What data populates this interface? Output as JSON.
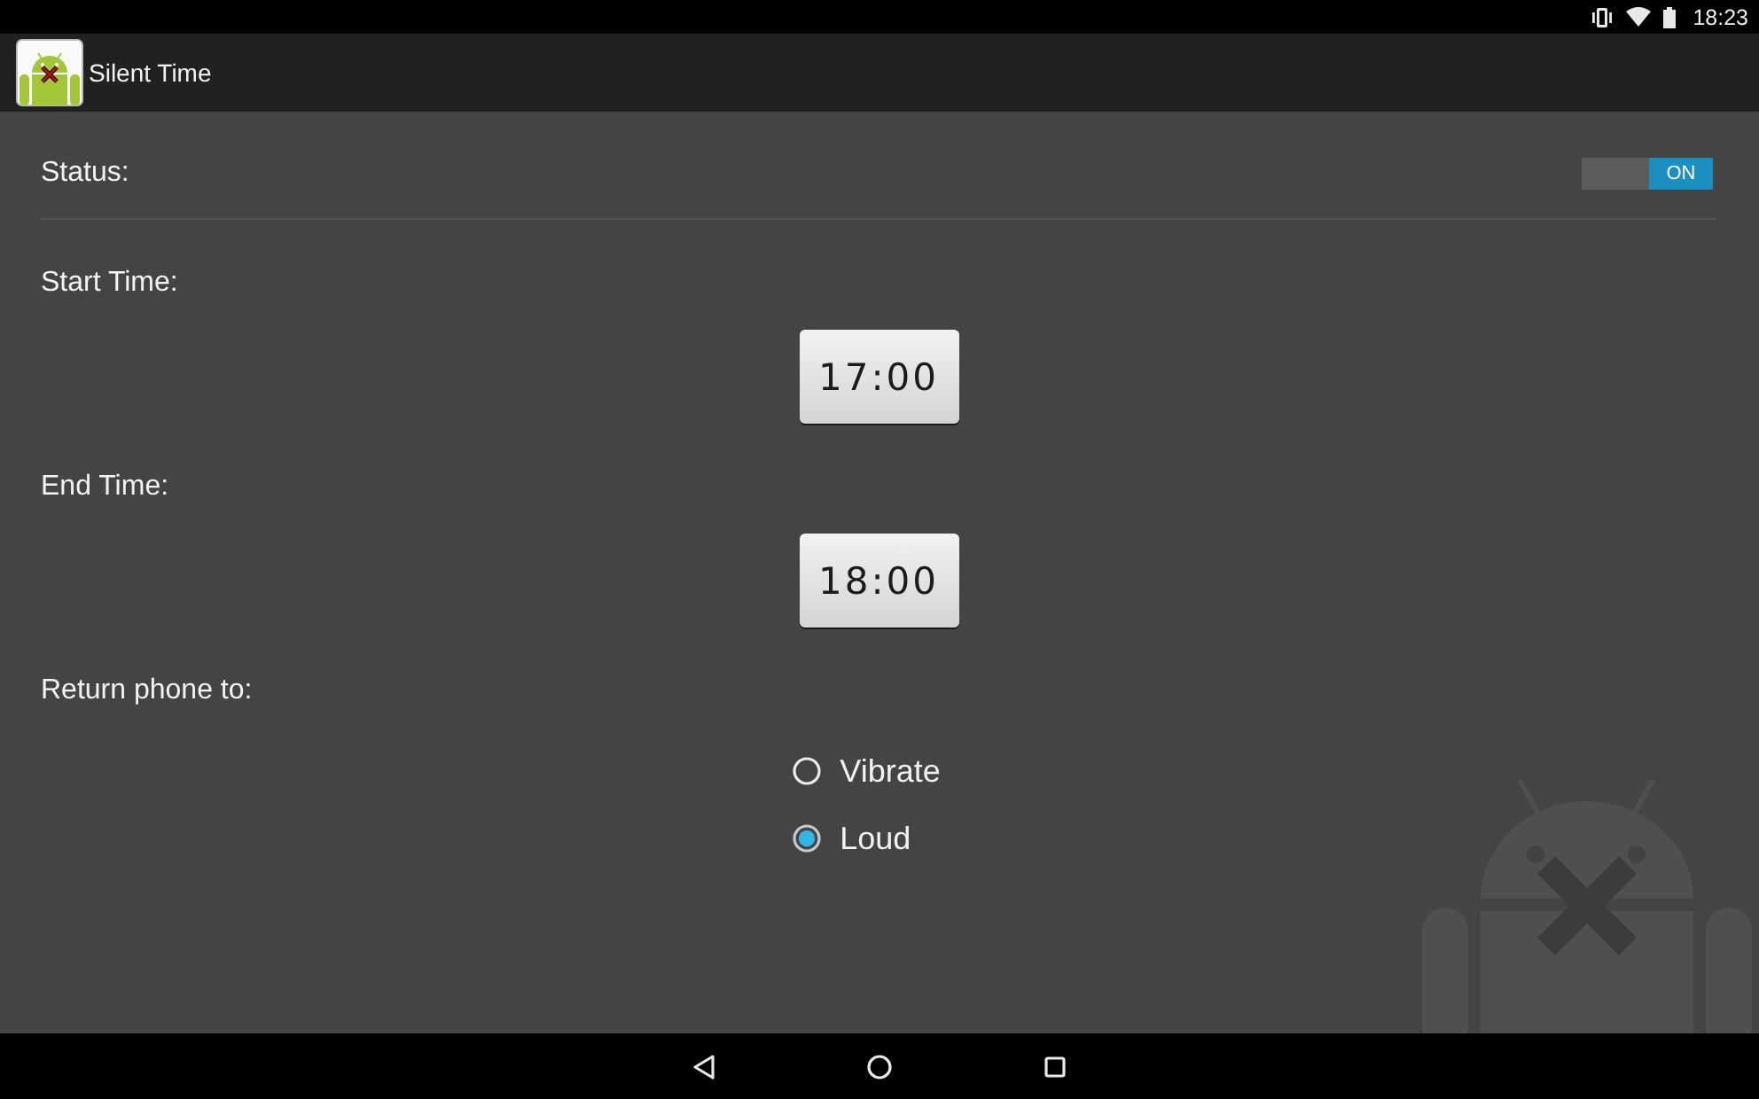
{
  "status_bar": {
    "time": "18:23"
  },
  "app_bar": {
    "title": "Silent Time"
  },
  "settings": {
    "status": {
      "label": "Status:",
      "toggle": {
        "on": true,
        "label": "ON"
      }
    },
    "start_time": {
      "label": "Start Time:",
      "value": "17:00"
    },
    "end_time": {
      "label": "End Time:",
      "value": "18:00"
    },
    "return_phone_to": {
      "label": "Return phone to:",
      "options": [
        {
          "label": "Vibrate",
          "selected": false
        },
        {
          "label": "Loud",
          "selected": true
        }
      ]
    }
  }
}
